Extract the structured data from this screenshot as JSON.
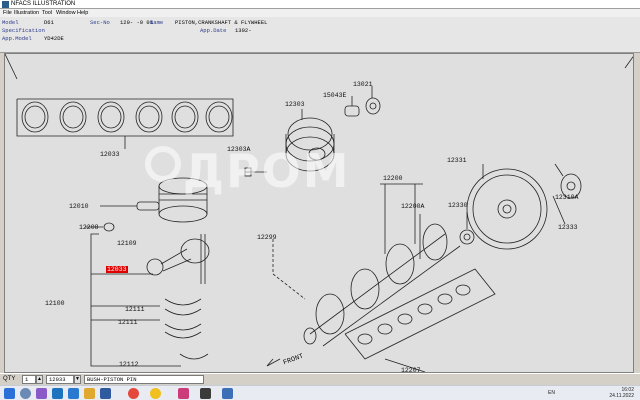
{
  "window": {
    "title": "NFACS ILLUSTRATION"
  },
  "menu": [
    "File",
    "Illustration",
    "Tool",
    "Window",
    "Help"
  ],
  "header": {
    "model_label": "Model",
    "model_value": "D61",
    "sec_label": "Sec-No",
    "sec_value": "120-  -0 01",
    "name_label": "Name",
    "name_value": "PISTON,CRANKSHAFT & FLYWHEEL",
    "spec_label": "Specification",
    "appdate_label": "App.Date",
    "appdate_value": "1302-",
    "appmodel_label": "App.Model",
    "appmodel_value": "YD42DE"
  },
  "drawing": {
    "watermark": "ДРОМ",
    "front_label": "FRONT",
    "callouts": [
      "12033",
      "12303",
      "15043E",
      "13021",
      "12303A",
      "12010",
      "12208",
      "12109",
      "12033",
      "12100",
      "12111",
      "12111",
      "12112",
      "12299",
      "12200",
      "12200A",
      "12331",
      "12330",
      "12310A",
      "12333",
      "12207",
      "12033"
    ],
    "selected_callout": "12033"
  },
  "status": {
    "qty_label": "QTY",
    "qty_value": "1",
    "part_no": "12033",
    "part_desc": "BUSH-PISTON PIN"
  },
  "taskbar": {
    "lang": "EN",
    "time": "16:02",
    "date": "24.11.2022"
  }
}
